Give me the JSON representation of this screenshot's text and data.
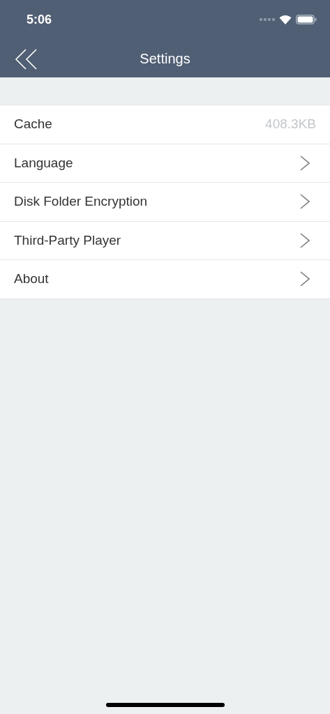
{
  "status_bar": {
    "time": "5:06"
  },
  "nav_bar": {
    "title": "Settings"
  },
  "settings": [
    {
      "kind": "value",
      "label": "Cache",
      "value": "408.3KB"
    },
    {
      "kind": "link",
      "label": "Language"
    },
    {
      "kind": "link",
      "label": "Disk Folder Encryption"
    },
    {
      "kind": "link",
      "label": "Third-Party Player"
    },
    {
      "kind": "link",
      "label": "About"
    }
  ]
}
